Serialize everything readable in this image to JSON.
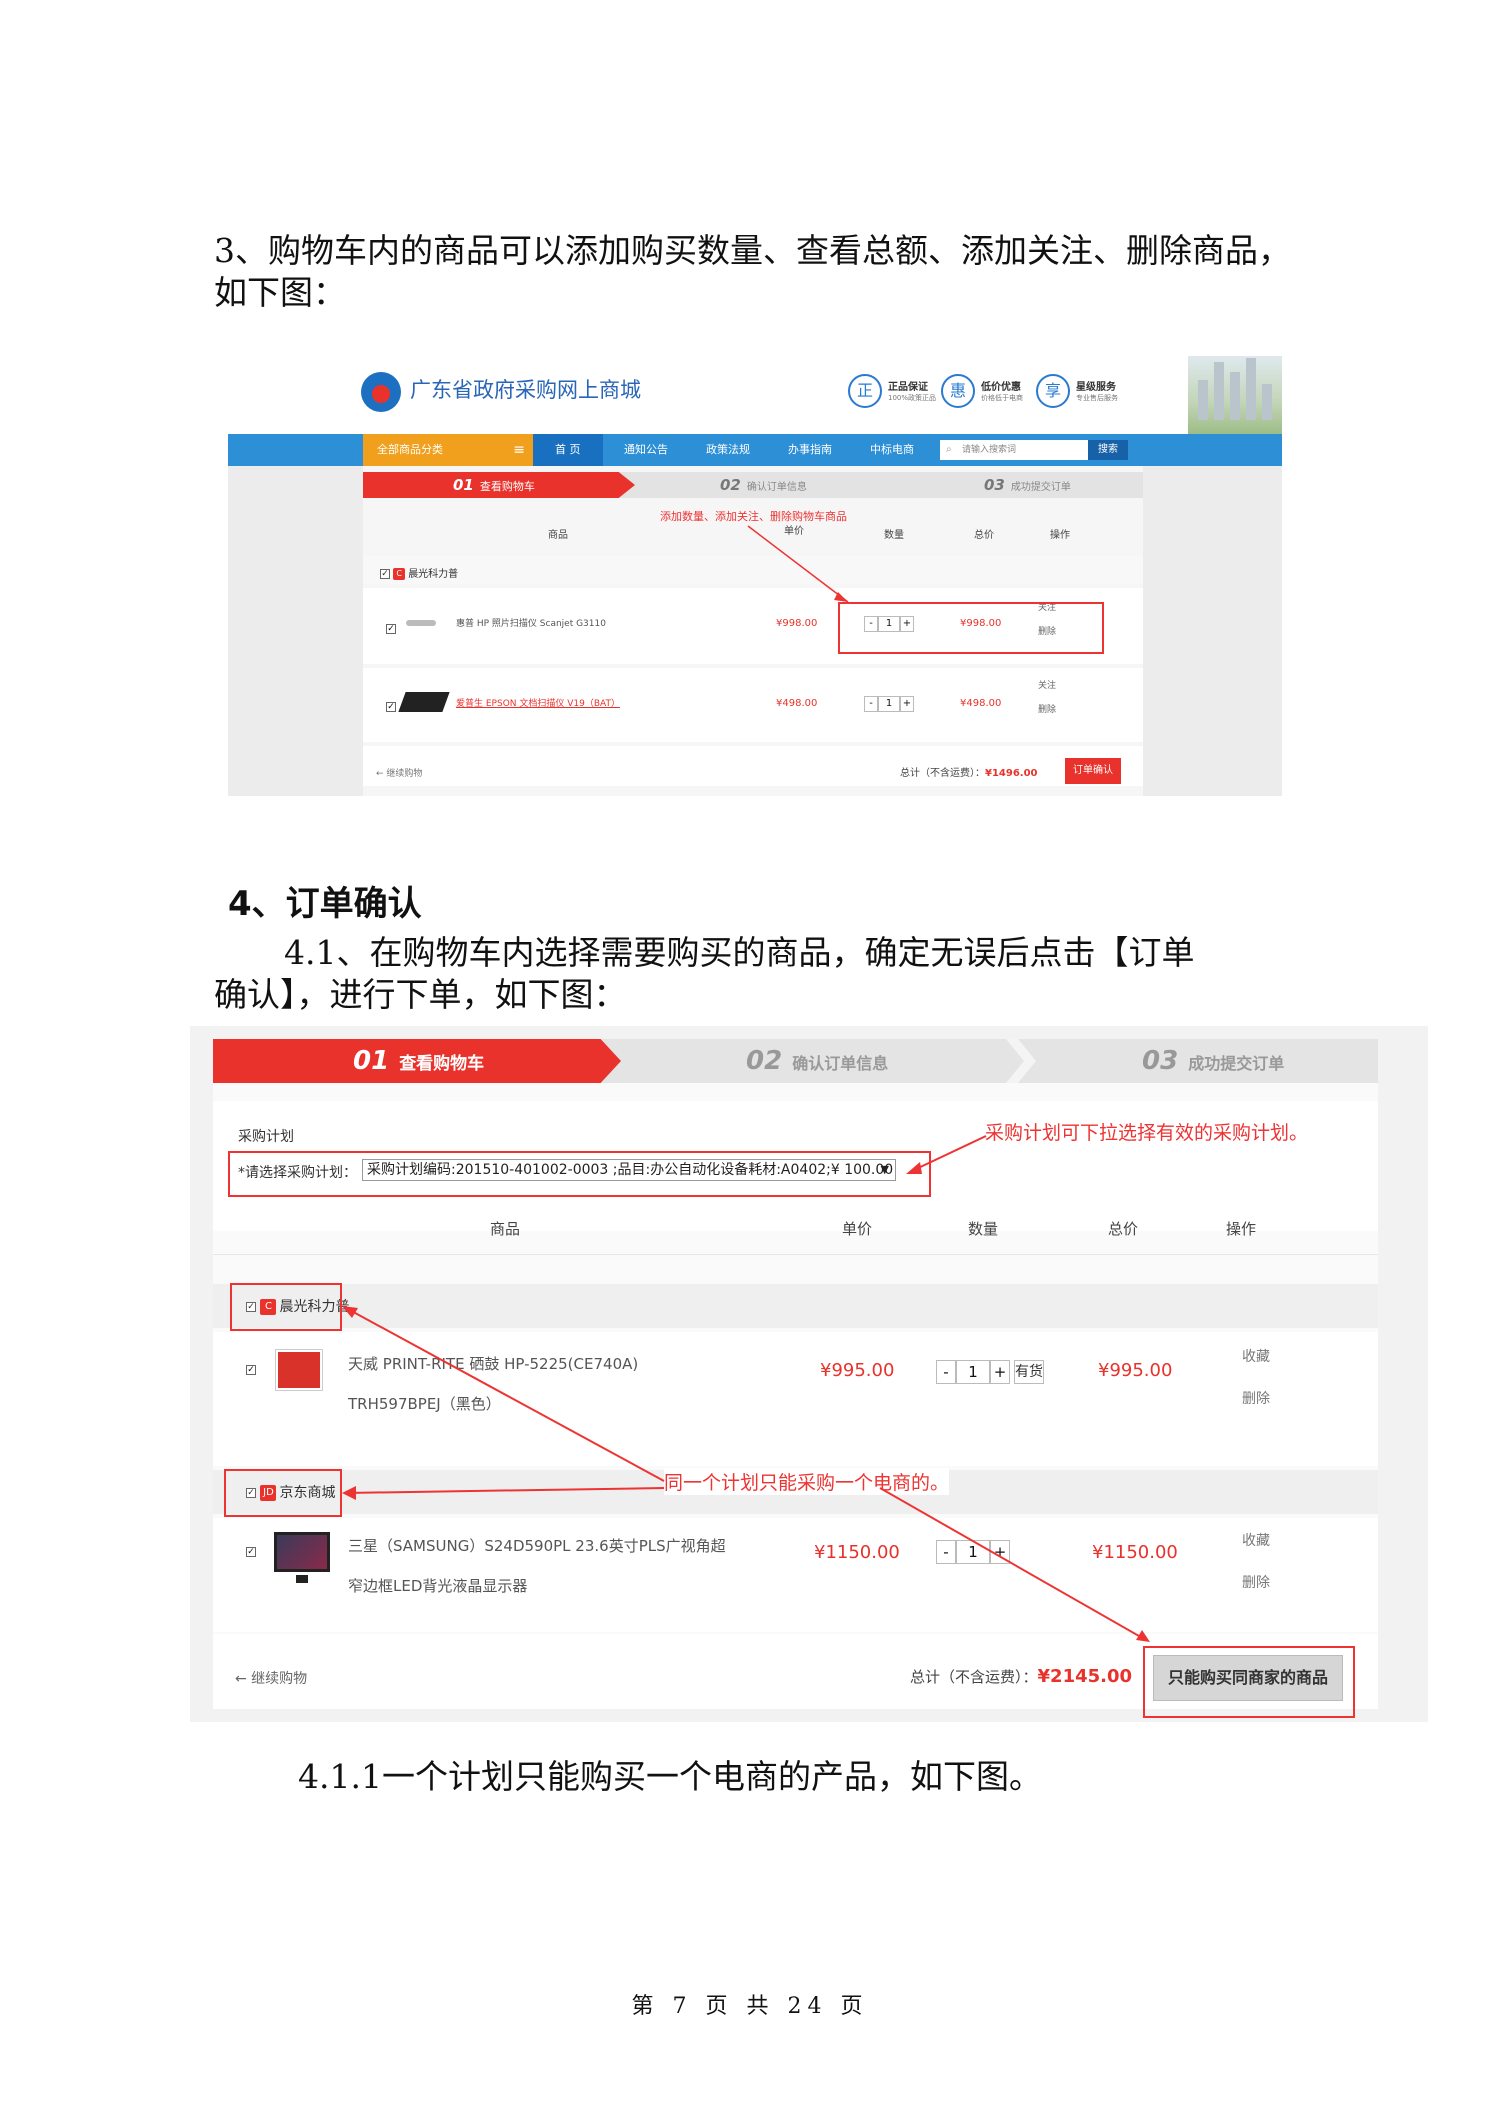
{
  "section3": {
    "line1": "3、购物车内的商品可以添加购买数量、查看总额、添加关注、删除商品，",
    "line2": "如下图："
  },
  "screenshot1": {
    "site_title": "广东省政府采购网上商城",
    "badges": [
      {
        "icon": "正",
        "title": "正品保证",
        "sub": "100%政策正品"
      },
      {
        "icon": "惠",
        "title": "低价优惠",
        "sub": "价格低于电商"
      },
      {
        "icon": "享",
        "title": "星级服务",
        "sub": "专业售后服务"
      }
    ],
    "all_categories": "全部商品分类",
    "menu_icon": "≡",
    "nav": [
      "首 页",
      "通知公告",
      "政策法规",
      "办事指南",
      "中标电商"
    ],
    "search_placeholder": "请输入搜索词",
    "search_button": "搜索",
    "steps": [
      {
        "num": "01",
        "label": "查看购物车"
      },
      {
        "num": "02",
        "label": "确认订单信息"
      },
      {
        "num": "03",
        "label": "成功提交订单"
      }
    ],
    "annotation": "添加数量、添加关注、删除购物车商品",
    "columns": {
      "product": "商品",
      "unit_price": "单价",
      "qty": "数量",
      "total": "总价",
      "ops": "操作"
    },
    "shop": "晨光科力普",
    "items": [
      {
        "name": "惠普 HP 照片扫描仪 Scanjet G3110",
        "price": "¥998.00",
        "qty": "1",
        "total": "¥998.00",
        "follow": "关注",
        "delete": "删除"
      },
      {
        "name": "爱普生 EPSON 文档扫描仪 V19（BAT）",
        "price": "¥498.00",
        "qty": "1",
        "total": "¥498.00",
        "follow": "关注",
        "delete": "删除"
      }
    ],
    "continue": "← 继续购物",
    "total_label": "总计（不含运费）：",
    "total_value": "¥1496.00",
    "confirm_button": "订单确认"
  },
  "section4": {
    "heading": "4、订单确认",
    "para_line1": "4.1、在购物车内选择需要购买的商品，确定无误后点击【订单",
    "para_line2": "确认】，进行下单，如下图："
  },
  "screenshot2": {
    "steps": [
      {
        "num": "01",
        "label": "查看购物车"
      },
      {
        "num": "02",
        "label": "确认订单信息"
      },
      {
        "num": "03",
        "label": "成功提交订单"
      }
    ],
    "plan_title": "采购计划",
    "plan_label": "*请选择采购计划：",
    "plan_value": "采购计划编码:201510-401002-0003 ;品目:办公自动化设备耗材:A0402;¥ 100.00",
    "annotation_plan": "采购计划可下拉选择有效的采购计划。",
    "columns": {
      "product": "商品",
      "unit_price": "单价",
      "qty": "数量",
      "total": "总价",
      "ops": "操作"
    },
    "shops": [
      {
        "icon": "C",
        "name": "晨光科力普"
      },
      {
        "icon": "JD",
        "name": "京东商城"
      }
    ],
    "items": [
      {
        "name": "天威 PRINT-RITE 硒鼓 HP-5225(CE740A) TRH597BPEJ（黑色）",
        "price": "¥995.00",
        "qty": "1",
        "stock": "有货",
        "total": "¥995.00",
        "collect": "收藏",
        "delete": "删除"
      },
      {
        "name": "三星（SAMSUNG）S24D590PL 23.6英寸PLS广视角超窄边框LED背光液晶显示器",
        "price": "¥1150.00",
        "qty": "1",
        "total": "¥1150.00",
        "collect": "收藏",
        "delete": "删除"
      }
    ],
    "annotation_shop": "同一个计划只能采购一个电商的。",
    "continue": "← 继续购物",
    "total_label": "总计（不含运费）：",
    "total_value": "¥2145.00",
    "only_button": "只能购买同商家的商品"
  },
  "section411": "4.1.1一个计划只能购买一个电商的产品，如下图。",
  "footer": "第 7 页 共 24 页"
}
